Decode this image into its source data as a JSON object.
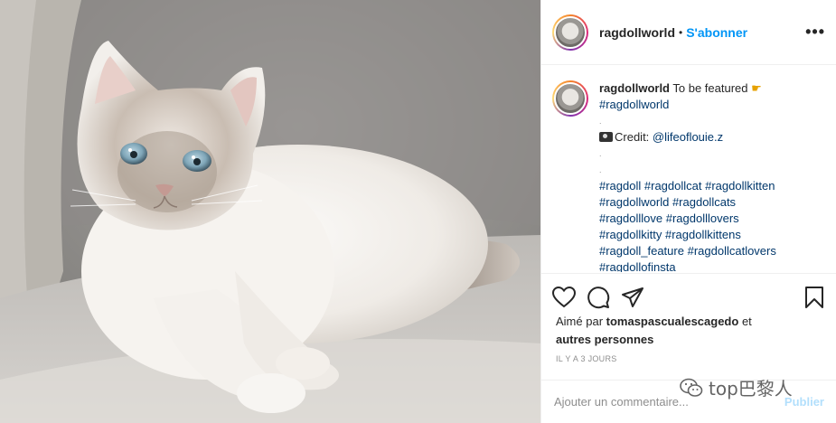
{
  "post": {
    "username": "ragdollworld",
    "follow_label": "S'abonner",
    "more_label": "•••"
  },
  "caption": {
    "username": "ragdollworld",
    "text": "To be featured",
    "emoji_icon": "pointing-hand-icon",
    "first_tag": "#ragdollworld",
    "separator": ".",
    "credit_prefix": "Credit: ",
    "credit_mention": "@lifeoflouie.z",
    "hashtags": [
      [
        "#ragdoll",
        "#ragdollcat",
        "#ragdollkitten"
      ],
      [
        "#ragdollworld",
        "#ragdollcats"
      ],
      [
        "#ragdolllove",
        "#ragdolllovers"
      ],
      [
        "#ragdollkitty",
        "#ragdollkittens"
      ],
      [
        "#ragdoll_feature",
        "#ragdollcatlovers"
      ],
      [
        "#ragdollofinsta"
      ]
    ]
  },
  "likes": {
    "prefix": "Aimé par ",
    "user": "tomaspascualescagedo",
    "middle": " et",
    "suffix": "autres personnes"
  },
  "timestamp": "IL Y A 3 JOURS",
  "comment_box": {
    "placeholder": "Ajouter un commentaire...",
    "publish_label": "Publier"
  },
  "watermark": "top巴黎人",
  "colors": {
    "accent": "#0095f6",
    "tag": "#00376b",
    "muted": "#8e8e8e",
    "publish_disabled": "#b2dffc"
  }
}
